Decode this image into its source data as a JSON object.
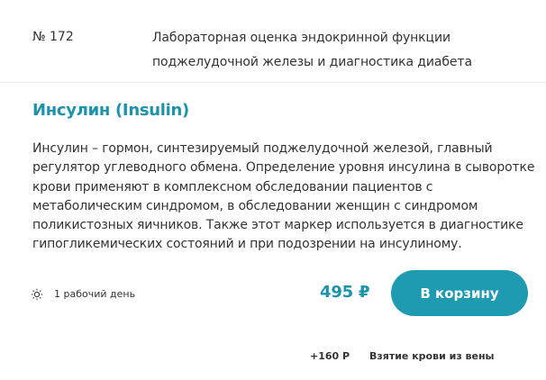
{
  "test": {
    "number": "№ 172",
    "category_line1": "Лабораторная оценка эндокринной функции",
    "category_line2": "поджелудочной железы и диагностика диабета",
    "title": "Инсулин (Insulin)",
    "description": "Инсулин – гормон, синтезируемый поджелудочной железой, главный регулятор углеводного обмена. Определение уровня инсулина в сыворотке крови применяют в комплексном обследовании пациентов с метаболическим синдромом, в обследовании женщин с синдромом поликистозных яичников. Также этот маркер используется в диагностике гипогликемических состояний и при подозрении на инсулиному.",
    "duration_icon": "sun-icon",
    "duration": "1 рабочий день",
    "price": "495 ₽",
    "cart_button_label": "В корзину"
  },
  "extra_service": {
    "price": "+160 Р",
    "label": "Взятие крови из вены"
  },
  "colors": {
    "accent": "#1b93ad",
    "button": "#1e9bb1",
    "text": "#333333"
  }
}
